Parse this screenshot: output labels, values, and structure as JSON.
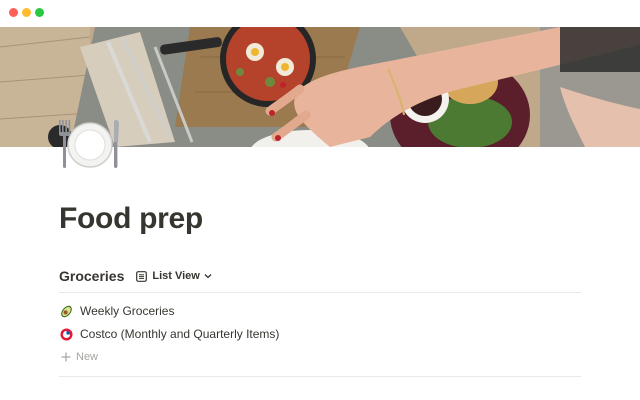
{
  "window": {
    "controls": [
      "close",
      "minimize",
      "zoom"
    ]
  },
  "cover": {
    "description_icon": "food-photo-cover"
  },
  "page": {
    "icon": "fork-and-knife-with-plate-icon",
    "title": "Food prep"
  },
  "database": {
    "title": "Groceries",
    "view_label": "List View",
    "view_icon": "list-view-icon",
    "items": [
      {
        "icon": "avocado-icon",
        "label": "Weekly Groceries"
      },
      {
        "icon": "costco-icon",
        "label": "Costco (Monthly and Quarterly Items)"
      }
    ],
    "new_label": "New"
  },
  "colors": {
    "text": "#37352f",
    "muted": "#a5a4a0",
    "divider": "#e9e9e7",
    "traffic_red": "#fe5f57",
    "traffic_yellow": "#febc2e",
    "traffic_green": "#28c840"
  }
}
